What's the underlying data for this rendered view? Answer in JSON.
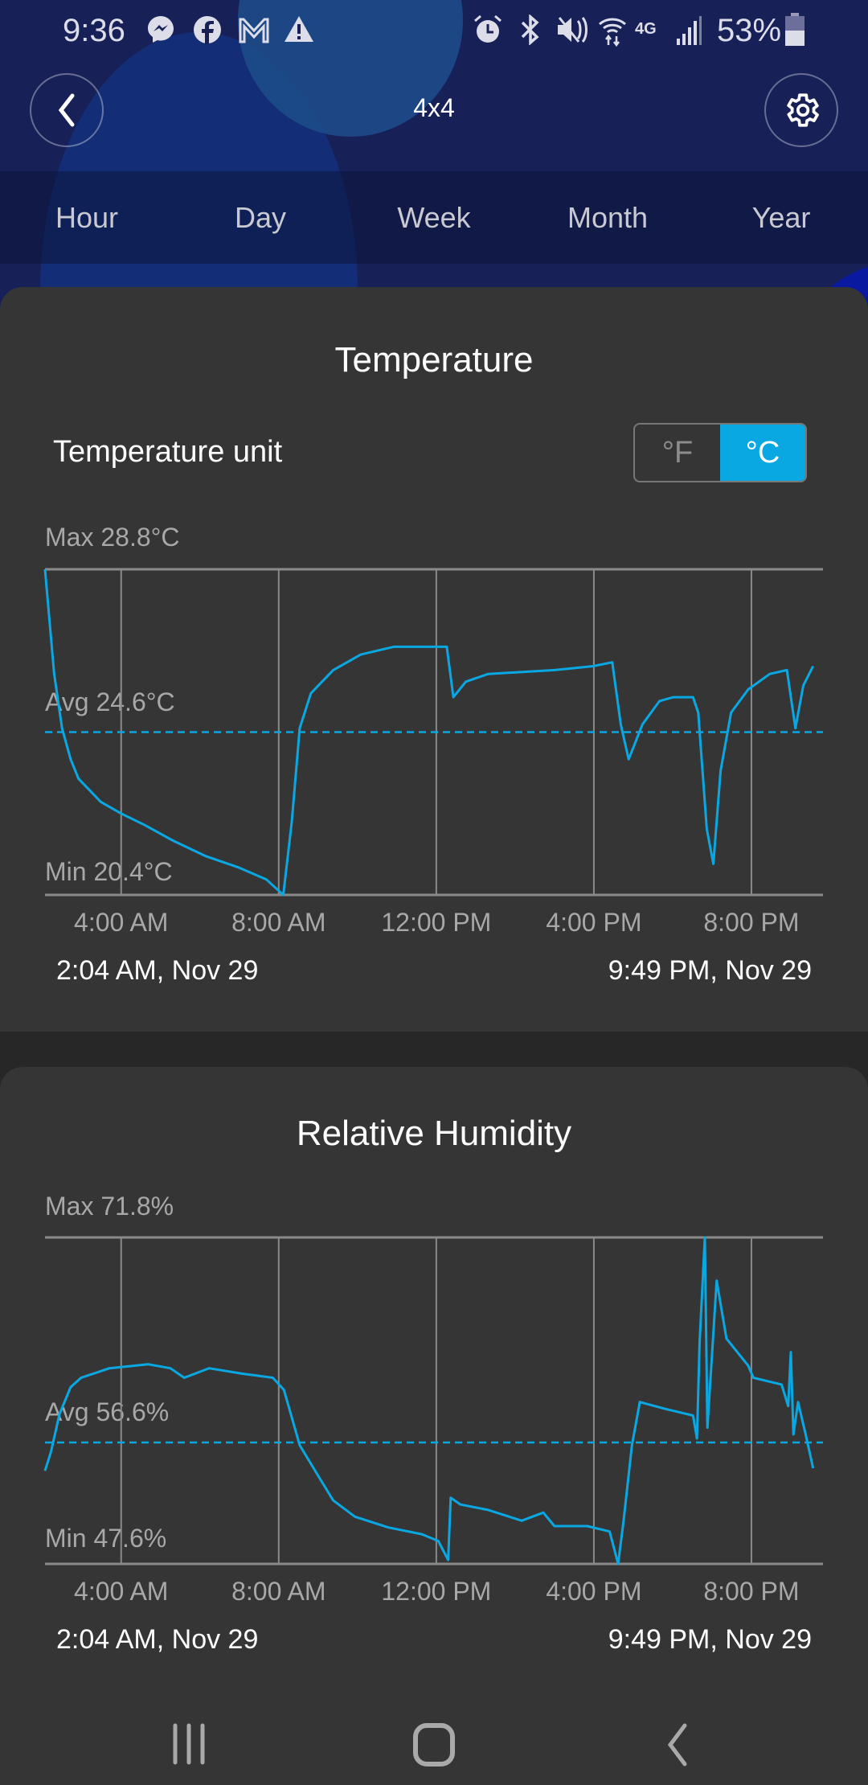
{
  "status_bar": {
    "time": "9:36",
    "battery": "53%",
    "network": "4G",
    "left_icons": [
      "messenger-icon",
      "facebook-icon",
      "gmail-icon",
      "warning-icon"
    ],
    "right_icons": [
      "alarm-icon",
      "bluetooth-icon",
      "mute-icon",
      "wifi-icon",
      "lte-icon",
      "signal-icon",
      "battery-icon"
    ]
  },
  "header": {
    "title": "4x4",
    "back_icon": "chevron-left-icon",
    "settings_icon": "gear-icon"
  },
  "tabs": [
    {
      "label": "Hour"
    },
    {
      "label": "Day"
    },
    {
      "label": "Week"
    },
    {
      "label": "Month"
    },
    {
      "label": "Year"
    }
  ],
  "temperature_card": {
    "title": "Temperature",
    "unit_label": "Temperature unit",
    "unit_options": [
      "°F",
      "°C"
    ],
    "unit_selected": "°C",
    "max_label": "Max 28.8°C",
    "avg_label": "Avg 24.6°C",
    "min_label": "Min 20.4°C",
    "start": "2:04 AM,  Nov 29",
    "end": "9:49 PM,  Nov 29"
  },
  "humidity_card": {
    "title": "Relative Humidity",
    "max_label": "Max 71.8%",
    "avg_label": "Avg 56.6%",
    "min_label": "Min 47.6%",
    "start": "2:04 AM,  Nov 29",
    "end": "9:49 PM,  Nov 29"
  },
  "colors": {
    "accent": "#0aa8e2",
    "header_bg": "#172158",
    "card_bg": "#353535",
    "grid": "#8a8a8a"
  },
  "chart_data": [
    {
      "type": "line",
      "title": "Temperature",
      "x_type": "time",
      "xlim": [
        "02:04",
        "21:49"
      ],
      "x_ticks": [
        "4:00 AM",
        "8:00 AM",
        "12:00 PM",
        "4:00 PM",
        "8:00 PM"
      ],
      "x_tick_times": [
        "04:00",
        "08:00",
        "12:00",
        "16:00",
        "20:00"
      ],
      "ylim": [
        20.4,
        28.8
      ],
      "avg": 24.6,
      "unit": "°C",
      "grid": true,
      "points": [
        [
          "02:04",
          28.8
        ],
        [
          "02:18",
          26.1
        ],
        [
          "02:30",
          24.7
        ],
        [
          "02:43",
          23.9
        ],
        [
          "02:55",
          23.4
        ],
        [
          "03:29",
          22.8
        ],
        [
          "04:00",
          22.5
        ],
        [
          "04:36",
          22.2
        ],
        [
          "05:19",
          21.8
        ],
        [
          "06:09",
          21.4
        ],
        [
          "07:00",
          21.1
        ],
        [
          "07:41",
          20.8
        ],
        [
          "08:07",
          20.4
        ],
        [
          "08:20",
          22.3
        ],
        [
          "08:32",
          24.7
        ],
        [
          "08:49",
          25.6
        ],
        [
          "09:23",
          26.2
        ],
        [
          "10:05",
          26.6
        ],
        [
          "10:55",
          26.8
        ],
        [
          "12:11",
          26.8
        ],
        [
          "12:16",
          26.8
        ],
        [
          "12:26",
          25.5
        ],
        [
          "12:45",
          25.9
        ],
        [
          "13:19",
          26.1
        ],
        [
          "15:00",
          26.2
        ],
        [
          "15:59",
          26.3
        ],
        [
          "16:28",
          26.4
        ],
        [
          "16:41",
          24.8
        ],
        [
          "16:53",
          23.9
        ],
        [
          "17:14",
          24.8
        ],
        [
          "17:40",
          25.4
        ],
        [
          "18:01",
          25.5
        ],
        [
          "18:31",
          25.5
        ],
        [
          "18:39",
          25.1
        ],
        [
          "18:52",
          22.1
        ],
        [
          "19:02",
          21.2
        ],
        [
          "19:13",
          23.6
        ],
        [
          "19:29",
          25.1
        ],
        [
          "19:55",
          25.7
        ],
        [
          "20:28",
          26.1
        ],
        [
          "20:54",
          26.2
        ],
        [
          "21:07",
          24.7
        ],
        [
          "21:19",
          25.8
        ],
        [
          "21:34",
          26.3
        ]
      ]
    },
    {
      "type": "line",
      "title": "Relative Humidity",
      "x_type": "time",
      "xlim": [
        "02:04",
        "21:49"
      ],
      "x_ticks": [
        "4:00 AM",
        "8:00 AM",
        "12:00 PM",
        "4:00 PM",
        "8:00 PM"
      ],
      "x_tick_times": [
        "04:00",
        "08:00",
        "12:00",
        "16:00",
        "20:00"
      ],
      "ylim": [
        47.6,
        71.8
      ],
      "avg": 56.6,
      "unit": "%",
      "grid": true,
      "points": [
        [
          "02:04",
          54.5
        ],
        [
          "02:13",
          55.9
        ],
        [
          "02:26",
          58.7
        ],
        [
          "02:43",
          60.7
        ],
        [
          "02:59",
          61.4
        ],
        [
          "03:42",
          62.1
        ],
        [
          "04:41",
          62.4
        ],
        [
          "05:15",
          62.1
        ],
        [
          "05:36",
          61.4
        ],
        [
          "06:14",
          62.1
        ],
        [
          "07:04",
          61.7
        ],
        [
          "07:51",
          61.4
        ],
        [
          "08:08",
          60.5
        ],
        [
          "08:32",
          56.4
        ],
        [
          "08:58",
          54.3
        ],
        [
          "09:23",
          52.3
        ],
        [
          "09:56",
          51.1
        ],
        [
          "10:47",
          50.3
        ],
        [
          "11:38",
          49.8
        ],
        [
          "12:03",
          49.3
        ],
        [
          "12:18",
          47.9
        ],
        [
          "12:22",
          52.5
        ],
        [
          "12:37",
          52.0
        ],
        [
          "13:19",
          51.6
        ],
        [
          "14:10",
          50.8
        ],
        [
          "14:43",
          51.4
        ],
        [
          "15:00",
          50.4
        ],
        [
          "15:50",
          50.4
        ],
        [
          "16:24",
          50.0
        ],
        [
          "16:37",
          47.6
        ],
        [
          "16:45",
          50.7
        ],
        [
          "16:58",
          56.4
        ],
        [
          "17:10",
          59.6
        ],
        [
          "17:48",
          59.1
        ],
        [
          "18:31",
          58.6
        ],
        [
          "18:37",
          56.9
        ],
        [
          "18:41",
          63.9
        ],
        [
          "18:49",
          71.8
        ],
        [
          "18:53",
          57.7
        ],
        [
          "19:07",
          68.6
        ],
        [
          "19:22",
          64.3
        ],
        [
          "19:55",
          62.3
        ],
        [
          "20:03",
          61.4
        ],
        [
          "20:46",
          60.9
        ],
        [
          "20:56",
          59.3
        ],
        [
          "21:00",
          63.3
        ],
        [
          "21:04",
          57.2
        ],
        [
          "21:11",
          59.6
        ],
        [
          "21:23",
          57.1
        ],
        [
          "21:34",
          54.7
        ]
      ]
    }
  ],
  "nav_bar": {
    "icons": [
      "recent-apps-icon",
      "home-icon",
      "back-icon"
    ]
  }
}
